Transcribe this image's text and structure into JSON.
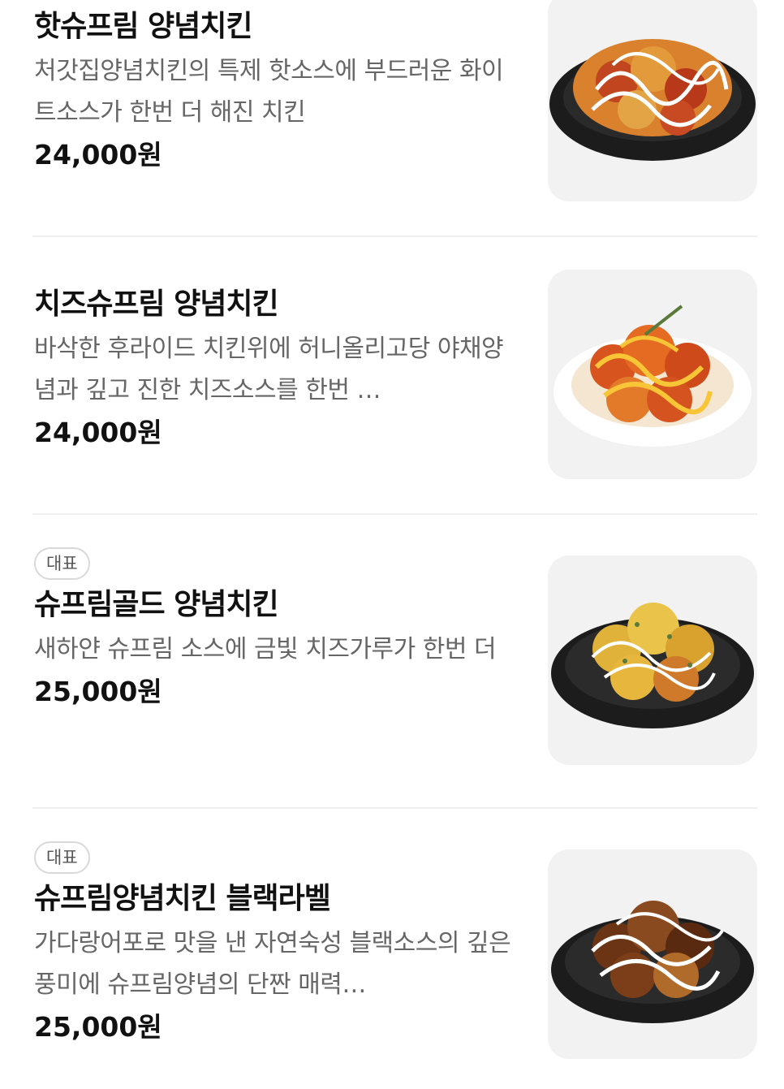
{
  "menu": {
    "items": [
      {
        "badge": "",
        "title": "핫슈프림 양념치킨",
        "description": "처갓집양념치킨의 특제 핫소스에 부드러운 화이트소스가 한번 더 해진 치킨",
        "price": "24,000원",
        "image_icon": "hot-supreme-chicken-photo"
      },
      {
        "badge": "",
        "title": "치즈슈프림 양념치킨",
        "description": "바삭한 후라이드 치킨위에 허니올리고당 야채양념과 깊고 진한 치즈소스를 한번 …",
        "price": "24,000원",
        "image_icon": "cheese-supreme-chicken-photo"
      },
      {
        "badge": "대표",
        "title": "슈프림골드 양념치킨",
        "description": "새하얀 슈프림 소스에 금빛 치즈가루가 한번 더",
        "price": "25,000원",
        "image_icon": "supreme-gold-chicken-photo"
      },
      {
        "badge": "대표",
        "title": "슈프림양념치킨 블랙라벨",
        "description": "가다랑어포로 맛을 낸 자연숙성 블랙소스의 깊은 풍미에 슈프림양념의 단짠 매력…",
        "price": "25,000원",
        "image_icon": "supreme-black-label-chicken-photo"
      }
    ]
  },
  "colors": {
    "text_primary": "#111111",
    "text_secondary": "#666666",
    "thumb_bg": "#f2f2f2",
    "divider": "#efefef",
    "badge_border": "#d9d9d9"
  }
}
